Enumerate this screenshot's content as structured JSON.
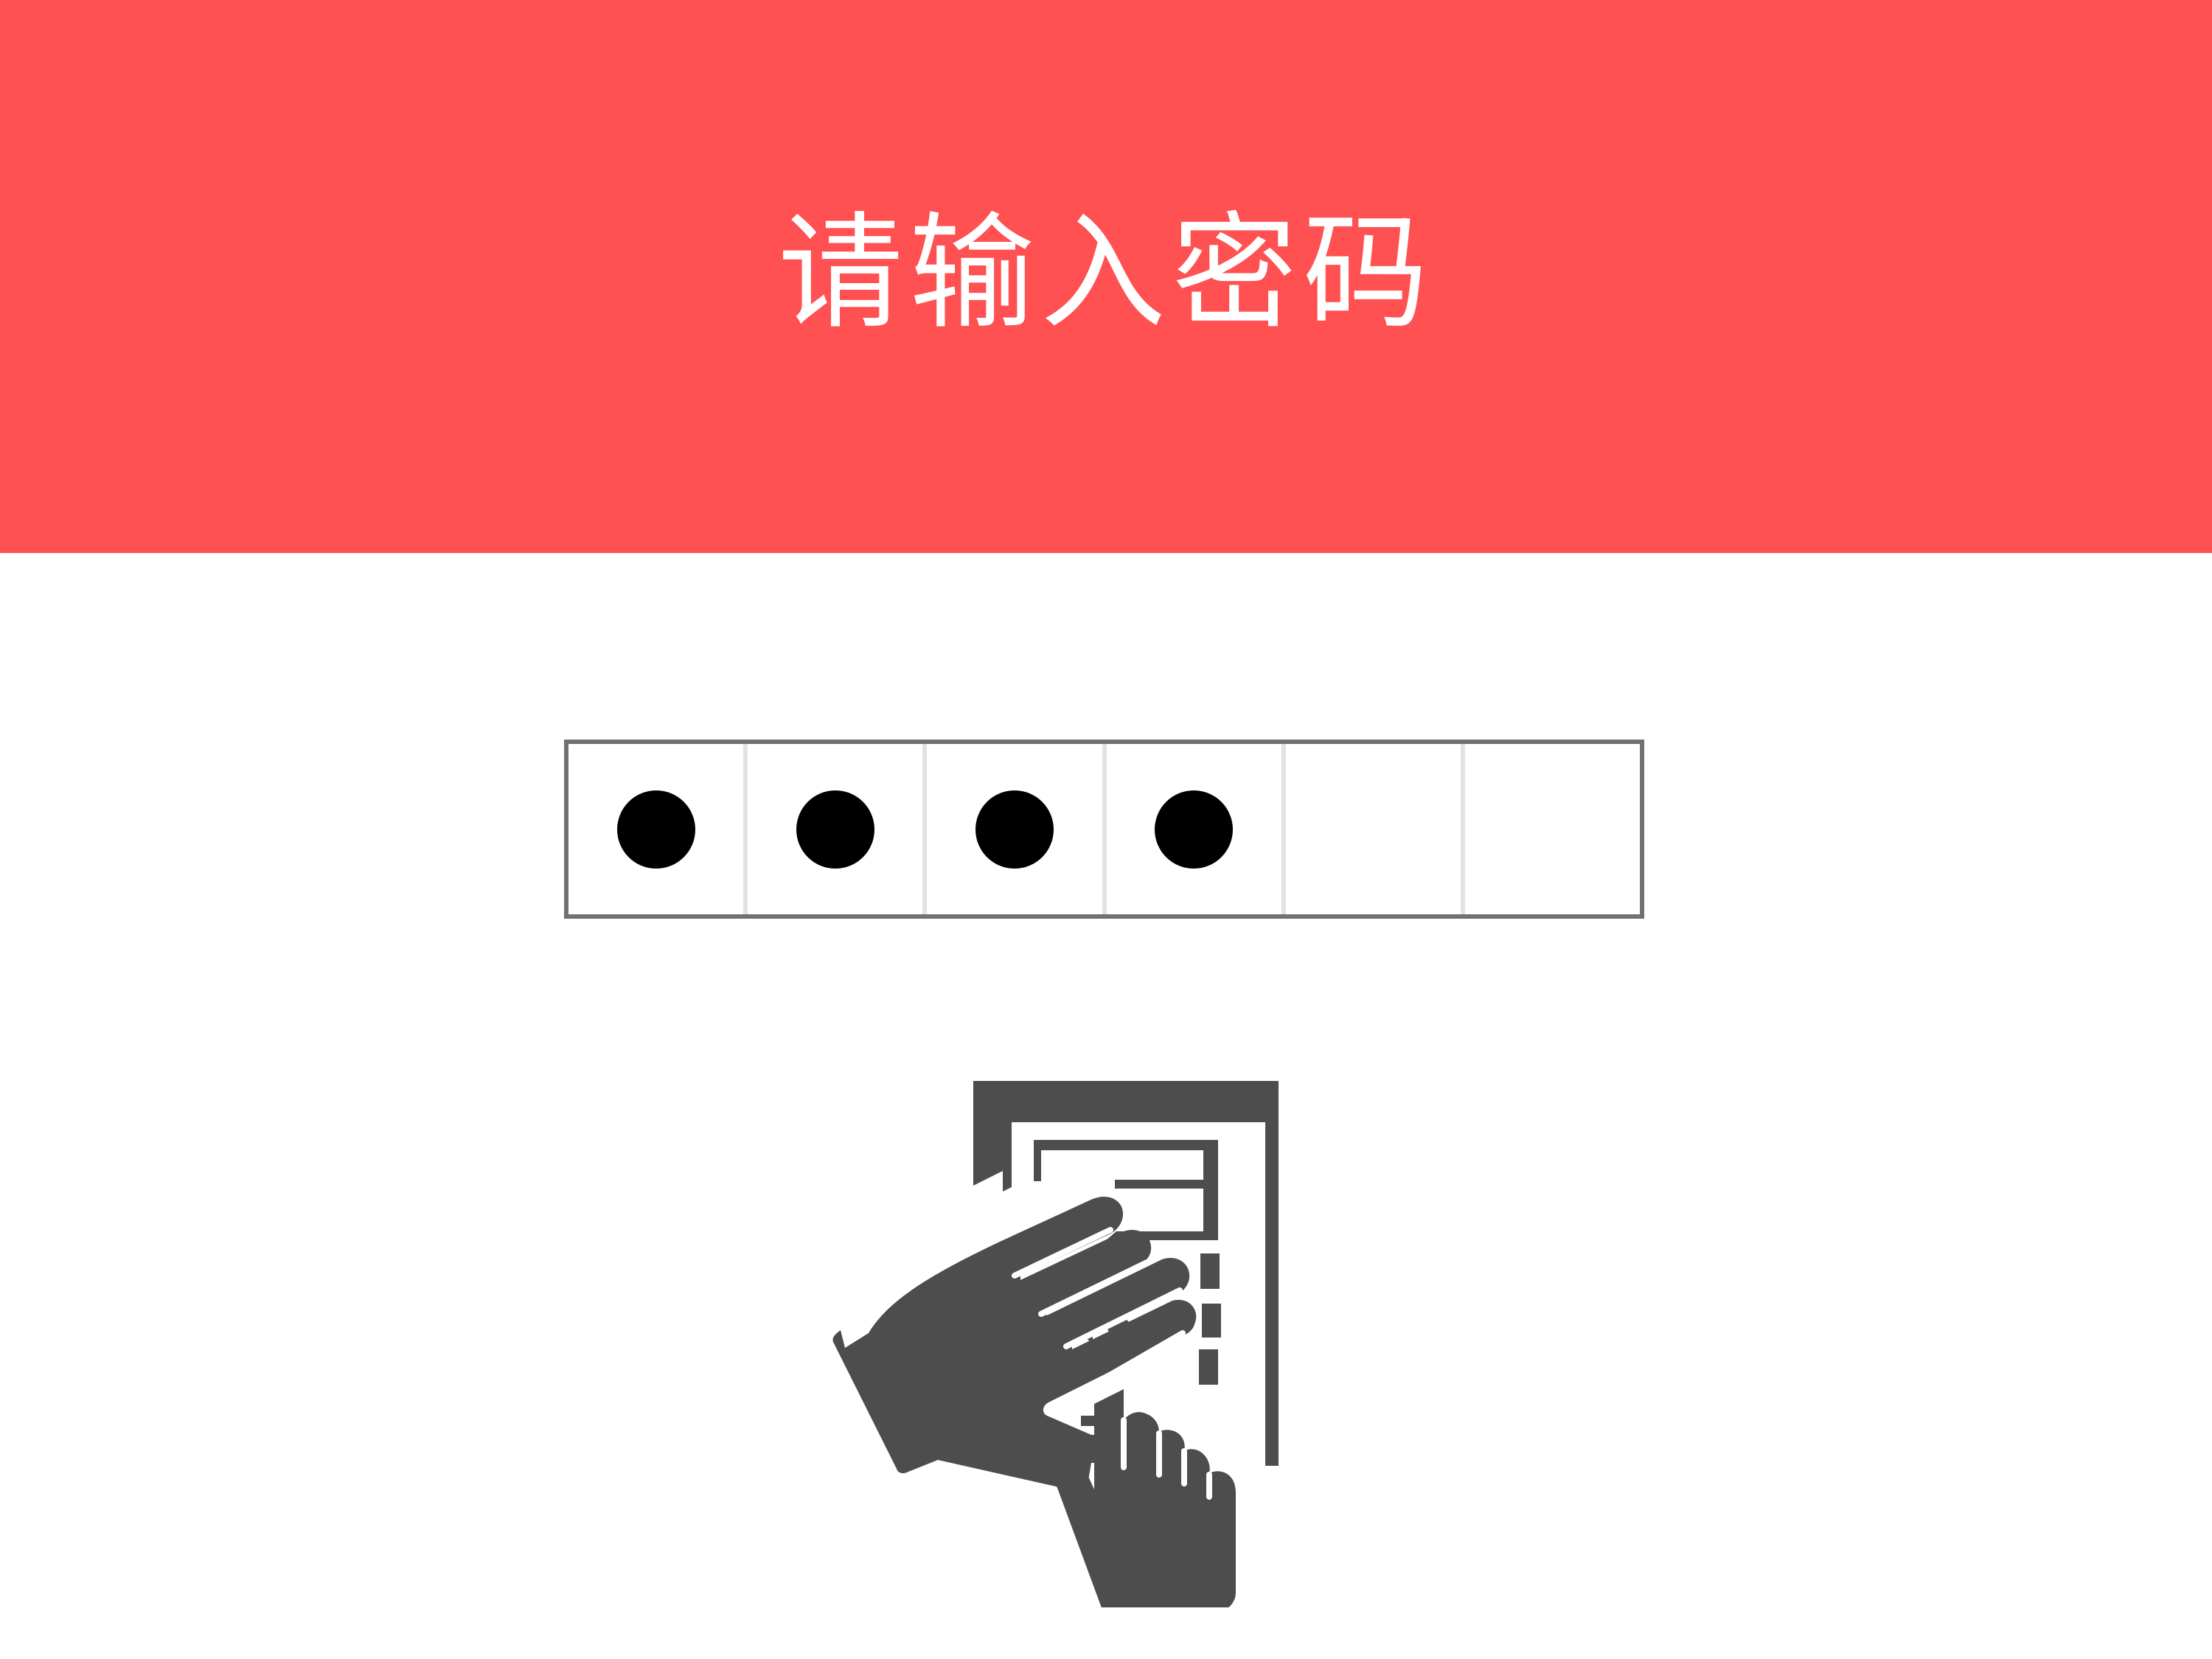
{
  "header": {
    "title": "请输入密码",
    "background_color": "#FF5052",
    "text_color": "#FFFFFF"
  },
  "pin_input": {
    "total_digits": 6,
    "entered_digits": 4,
    "dot_color": "#000000",
    "border_color": "#717171",
    "divider_color": "#E2E2E2"
  },
  "illustration": {
    "icon": "hand-entering-keypad-icon",
    "color": "#4D4D4D"
  }
}
